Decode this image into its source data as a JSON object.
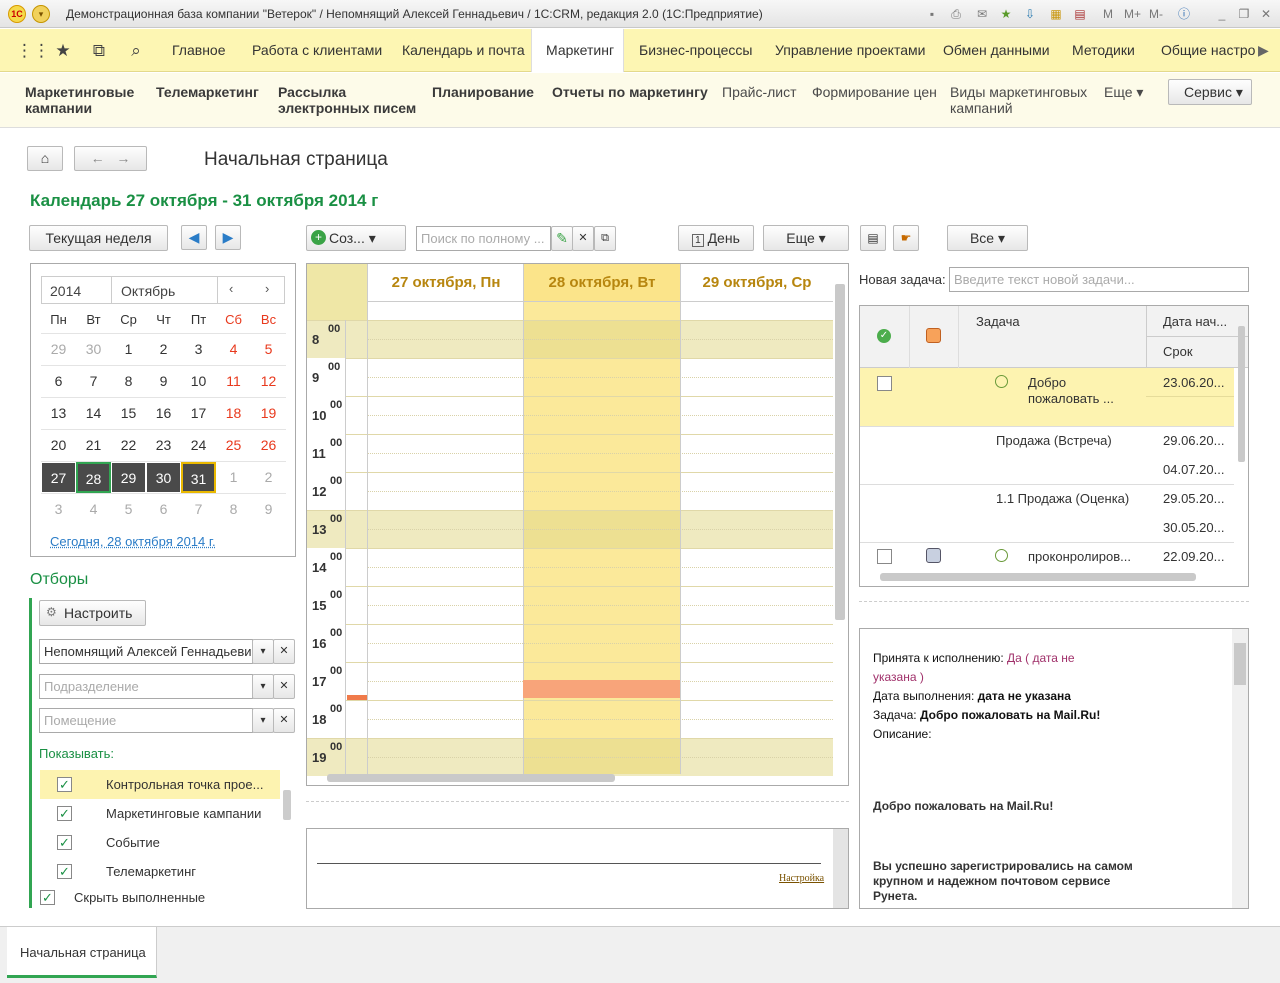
{
  "window": {
    "title": "Демонстрационная база компании \"Ветерок\" / Непомнящий Алексей Геннадьевич / 1С:CRM, редакция 2.0  (1С:Предприятие)"
  },
  "sections": [
    "Главное",
    "Работа с клиентами",
    "Календарь и почта",
    "Маркетинг",
    "Бизнес-процессы",
    "Управление проектами",
    "Обмен данными",
    "Методики",
    "Общие настро"
  ],
  "subnav": {
    "items": [
      "Маркетинговые кампании",
      "Телемаркетинг",
      "Рассылка электронных писем",
      "Планирование",
      "Отчеты по маркетингу",
      "Прайс-лист",
      "Формирование цен",
      "Виды маркетинговых кампаний"
    ],
    "more": "Еще",
    "service": "Сервис"
  },
  "page": {
    "title": "Начальная страница",
    "calendar_header": "Календарь 27 октября - 31 октября 2014 г"
  },
  "toolbar": {
    "current_week": "Текущая неделя",
    "create": "Соз...",
    "search_placeholder": "Поиск по полному ...",
    "day": "День",
    "more": "Еще",
    "all": "Все"
  },
  "mini": {
    "year": "2014",
    "month": "Октябрь",
    "weekdays": [
      "Пн",
      "Вт",
      "Ср",
      "Чт",
      "Пт",
      "Сб",
      "Вс"
    ],
    "weeks": [
      [
        "29",
        "30",
        "1",
        "2",
        "3",
        "4",
        "5"
      ],
      [
        "6",
        "7",
        "8",
        "9",
        "10",
        "11",
        "12"
      ],
      [
        "13",
        "14",
        "15",
        "16",
        "17",
        "18",
        "19"
      ],
      [
        "20",
        "21",
        "22",
        "23",
        "24",
        "25",
        "26"
      ],
      [
        "27",
        "28",
        "29",
        "30",
        "31",
        "1",
        "2"
      ],
      [
        "3",
        "4",
        "5",
        "6",
        "7",
        "8",
        "9"
      ]
    ],
    "today_link": "Сегодня, 28 октября 2014 г."
  },
  "filters": {
    "title": "Отборы",
    "configure": "Настроить",
    "user": "Непомнящий Алексей Геннадьеви",
    "division_ph": "Подразделение",
    "room_ph": "Помещение",
    "show_label": "Показывать:",
    "items": [
      "Контрольная точка прое...",
      "Маркетинговые кампании",
      "Событие",
      "Телемаркетинг"
    ],
    "hide_done": "Скрыть выполненные"
  },
  "calendar": {
    "days": [
      "27 октября, Пн",
      "28 октября, Вт",
      "29 октября, Ср"
    ],
    "hours": [
      "8",
      "9",
      "10",
      "11",
      "12",
      "13",
      "14",
      "15",
      "16",
      "17",
      "18",
      "19"
    ],
    "minutes": "00"
  },
  "setup_link": "Настройка",
  "tasks": {
    "new_label": "Новая задача:",
    "new_placeholder": "Введите текст новой задачи...",
    "col_task": "Задача",
    "col_start": "Дата нач...",
    "col_due": "Срок",
    "rows": [
      {
        "task": "Добро пожаловать ...",
        "start": "23.06.20...",
        "due": ""
      },
      {
        "task": "Продажа (Встреча)",
        "start": "29.06.20...",
        "due": "04.07.20..."
      },
      {
        "task": "1.1 Продажа (Оценка)",
        "start": "29.05.20...",
        "due": "30.05.20..."
      },
      {
        "task": "проконролиров...",
        "start": "22.09.20...",
        "due": ""
      }
    ]
  },
  "details": {
    "accepted_label": "Принята к исполнению:",
    "accepted_value": "Да ( дата не указана )",
    "done_label": "Дата выполнения:",
    "done_value": "дата не указана",
    "task_label": "Задача:",
    "task_value": "Добро пожаловать на Mail.Ru!",
    "desc_label": "Описание:",
    "body_title": "Добро пожаловать на Mail.Ru!",
    "body_text": "Вы успешно зарегистрировались на самом крупном и надежном почтовом сервисе Рунета."
  },
  "bottom_tab": "Начальная страница"
}
